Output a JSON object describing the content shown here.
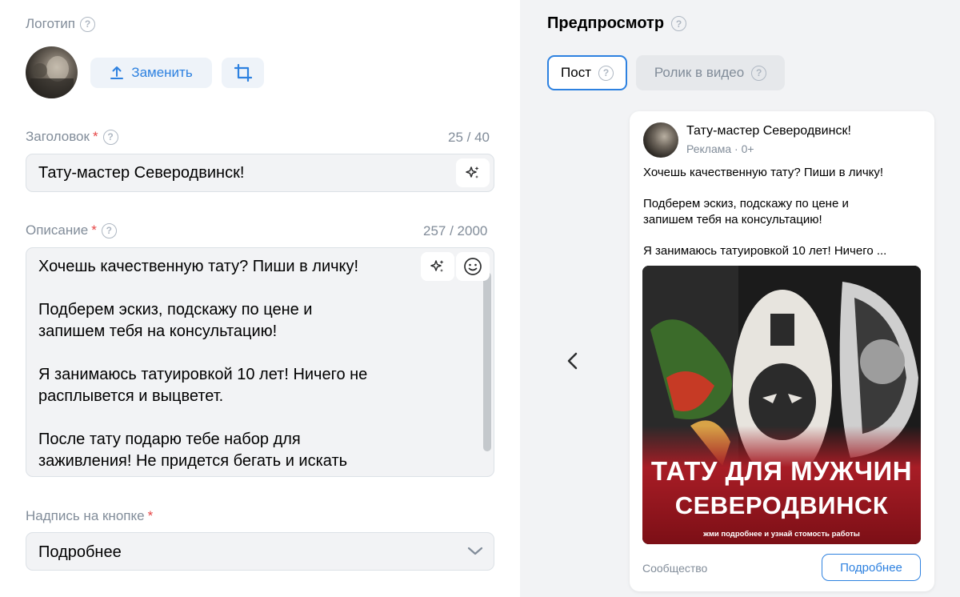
{
  "logo": {
    "label": "Логотип",
    "replace_label": "Заменить"
  },
  "headline": {
    "label": "Заголовок",
    "required_mark": "*",
    "counter": "25 / 40",
    "value": "Тату-мастер Северодвинск!"
  },
  "description": {
    "label": "Описание",
    "required_mark": "*",
    "counter": "257 / 2000",
    "value": "Хочешь качественную тату? Пиши в личку!\n\nПодберем эскиз, подскажу по цене и\nзапишем тебя на консультацию!\n\nЯ занимаюсь татуировкой 10 лет! Ничего не\nрасплывется и выцветет.\n\nПосле тату подарю тебе набор для\nзаживления! Не придется бегать и искать"
  },
  "button_caption": {
    "label": "Надпись на кнопке",
    "required_mark": "*",
    "value": "Подробнее"
  },
  "preview": {
    "title": "Предпросмотр",
    "tabs": [
      {
        "label": "Пост",
        "active": true
      },
      {
        "label": "Ролик в видео",
        "active": false
      }
    ],
    "card": {
      "name": "Тату-мастер Северодвинск!",
      "subtitle": "Реклама · 0+",
      "text": "Хочешь качественную тату? Пиши в личку!\n\nПодберем эскиз, подскажу по цене и\nзапишем тебя на консультацию!\n\nЯ занимаюсь татуировкой 10 лет! Ничего ...",
      "banner_line1": "ТАТУ ДЛЯ МУЖЧИН",
      "banner_line2": "СЕВЕРОДВИНСК",
      "banner_line3": "жми подробнее и узнай стомость работы",
      "footer_label": "Сообщество",
      "button_label": "Подробнее"
    }
  },
  "colors": {
    "accent": "#2d81e0",
    "required": "#e64646",
    "muted": "#818c99",
    "field_bg": "#f2f3f5"
  },
  "icons": [
    "help-icon",
    "upload-icon",
    "crop-icon",
    "sparkle-icon",
    "emoji-icon",
    "chevron-down-icon",
    "chevron-left-icon"
  ]
}
